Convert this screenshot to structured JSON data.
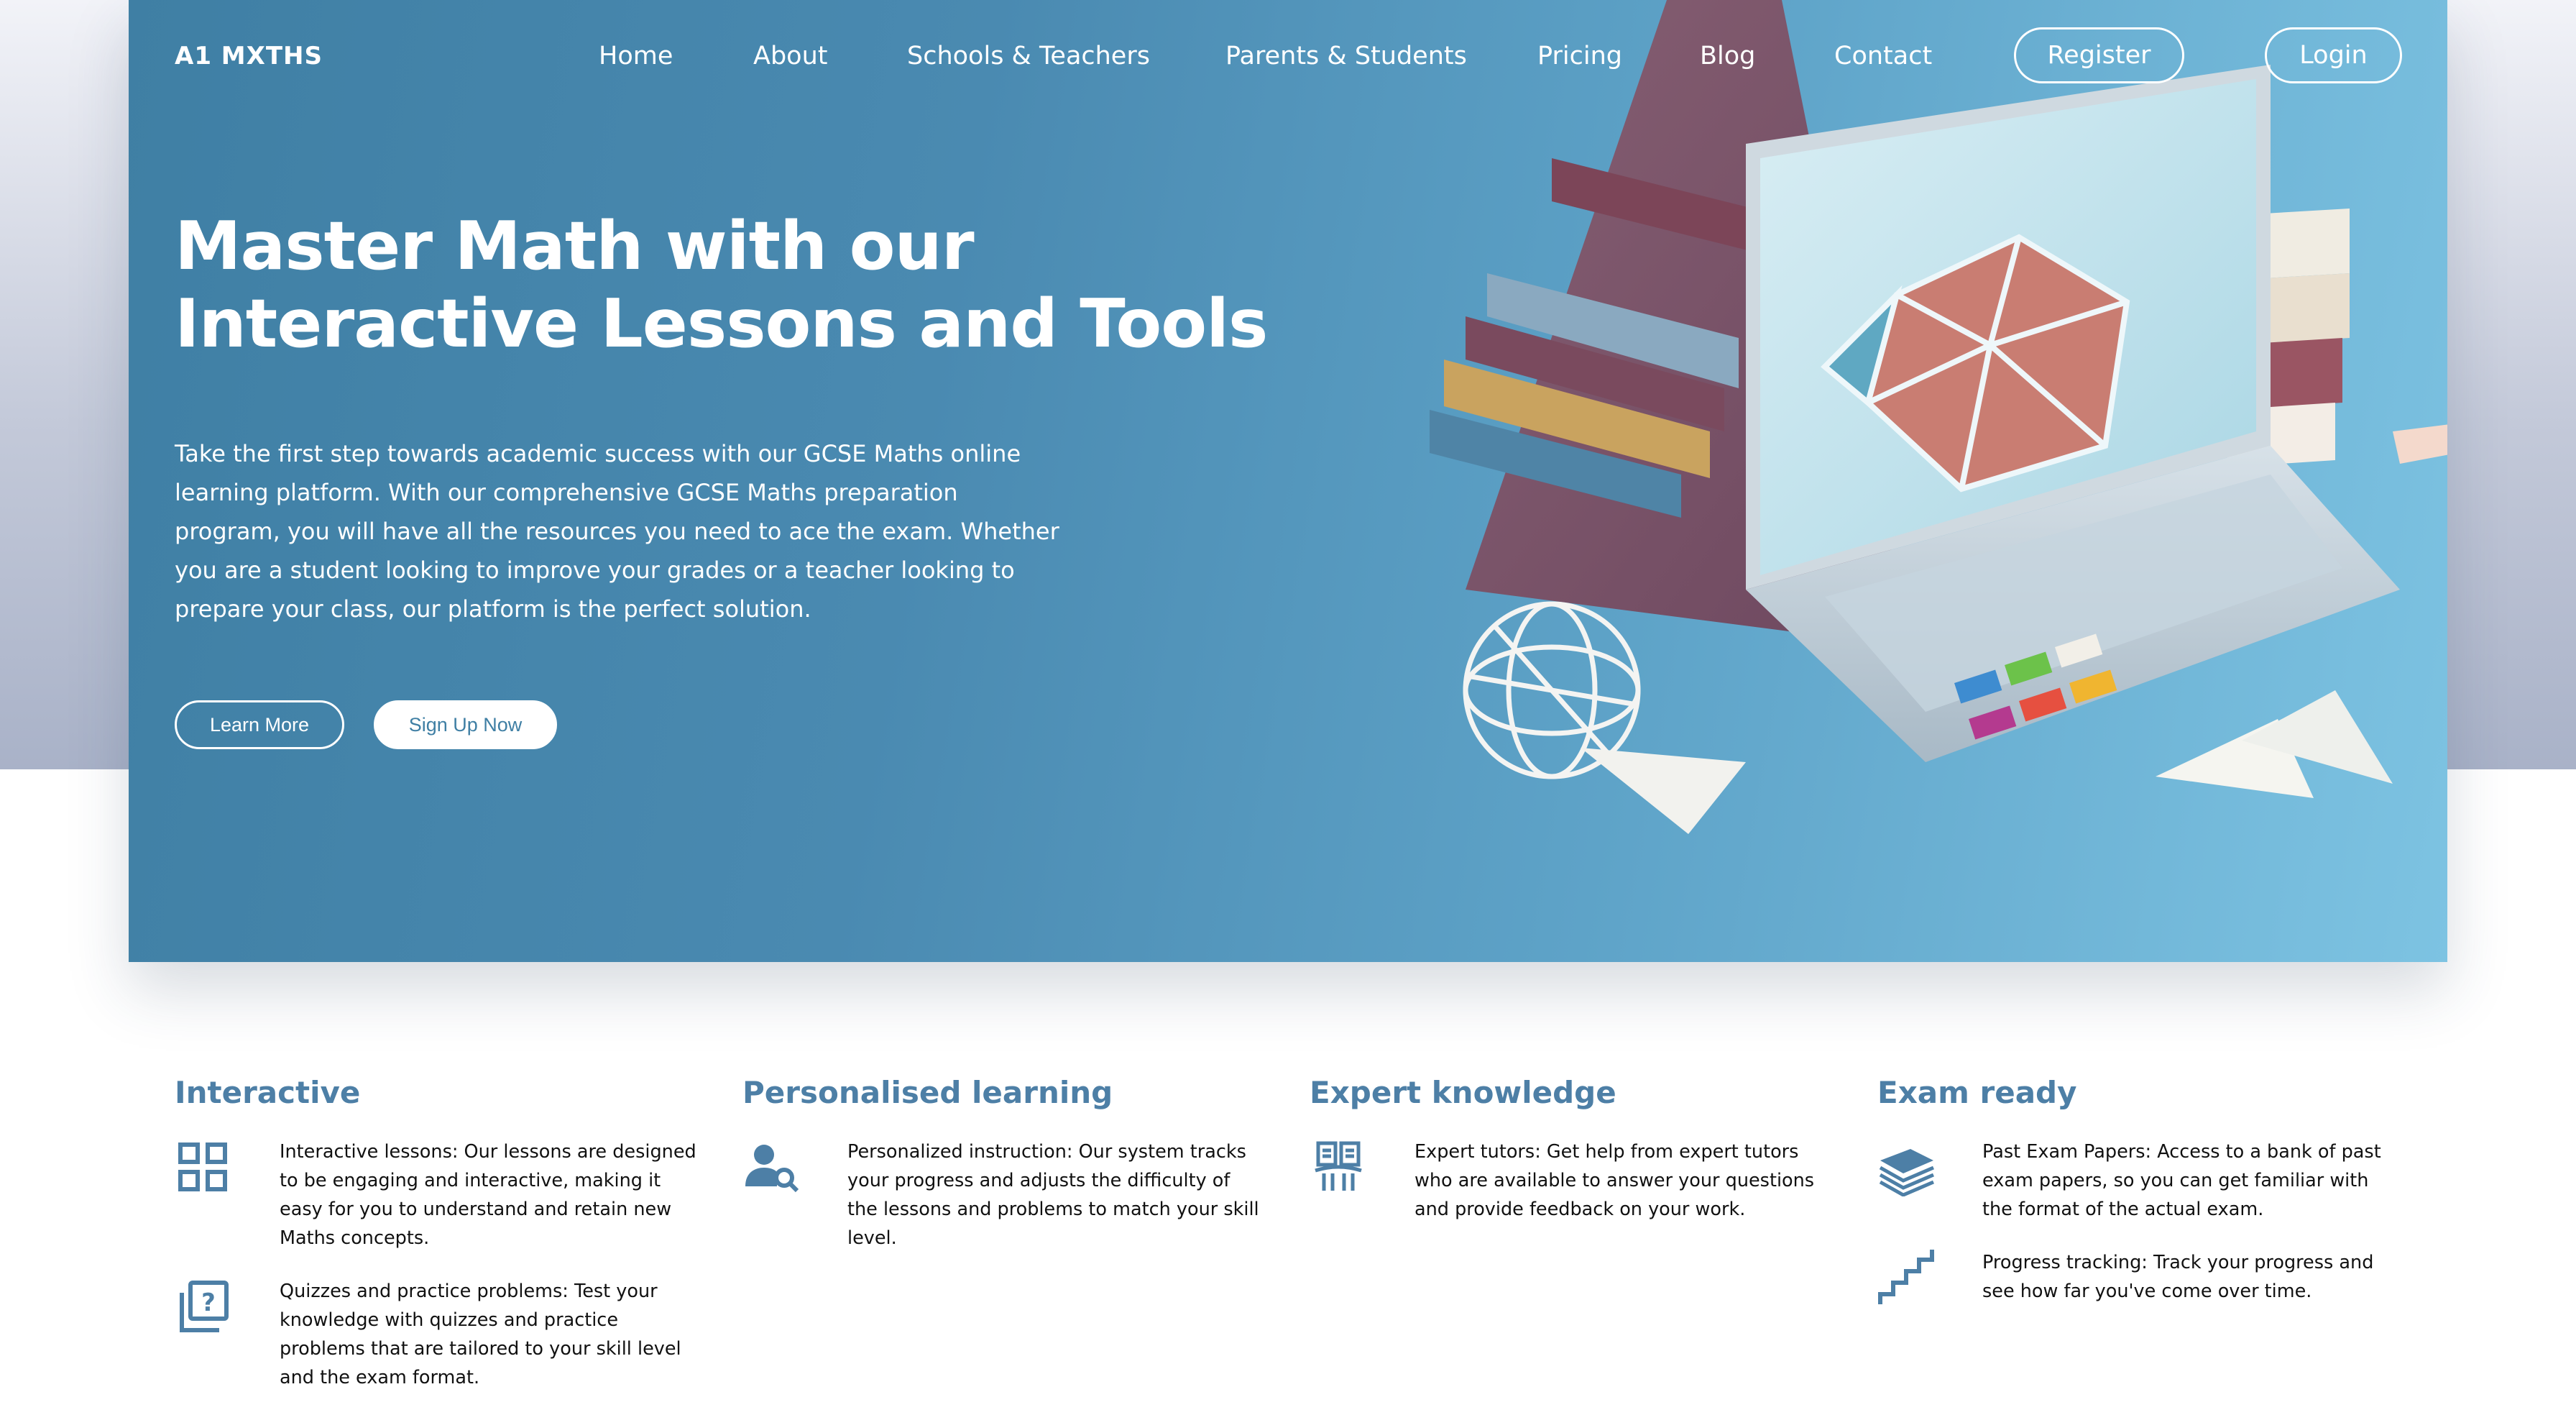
{
  "brand": "A1 MXTHS",
  "nav": {
    "links": [
      "Home",
      "About",
      "Schools & Teachers",
      "Parents & Students",
      "Pricing",
      "Blog",
      "Contact"
    ],
    "register": "Register",
    "login": "Login"
  },
  "hero": {
    "title": "Master Math with our Interactive Lessons and Tools",
    "text": "Take the first step towards academic success with our GCSE Maths online learning platform. With our comprehensive GCSE Maths preparation program, you will have all the resources you need to ace the exam. Whether you are a student looking to improve your grades or a teacher looking to prepare your class, our platform is the perfect solution.",
    "learn_more": "Learn More",
    "sign_up": "Sign Up Now"
  },
  "features": [
    {
      "heading": "Interactive",
      "items": [
        {
          "icon": "grid-icon",
          "text": "Interactive lessons: Our lessons are designed to be engaging and interactive, making it easy for you to understand and retain new Maths concepts."
        },
        {
          "icon": "quiz-icon",
          "text": "Quizzes and practice problems: Test your knowledge with quizzes and practice problems that are tailored to your skill level and the exam format."
        }
      ]
    },
    {
      "heading": "Personalised learning",
      "items": [
        {
          "icon": "user-search-icon",
          "text": "Personalized instruction: Our system tracks your progress and adjusts the difficulty of the lessons and problems to match your skill level."
        }
      ]
    },
    {
      "heading": "Expert knowledge",
      "items": [
        {
          "icon": "book-pillar-icon",
          "text": "Expert tutors: Get help from expert tutors who are available to answer your questions and provide feedback on your work."
        }
      ]
    },
    {
      "heading": "Exam ready",
      "items": [
        {
          "icon": "stack-icon",
          "text": "Past Exam Papers: Access to a bank of past exam papers, so you can get familiar with the format of the actual exam."
        },
        {
          "icon": "stairs-icon",
          "text": "Progress tracking: Track your progress and see how far you've come over time."
        }
      ]
    }
  ],
  "colors": {
    "hero": "#4a8ab1",
    "accent": "#4d7fa6",
    "text": "#111111"
  }
}
